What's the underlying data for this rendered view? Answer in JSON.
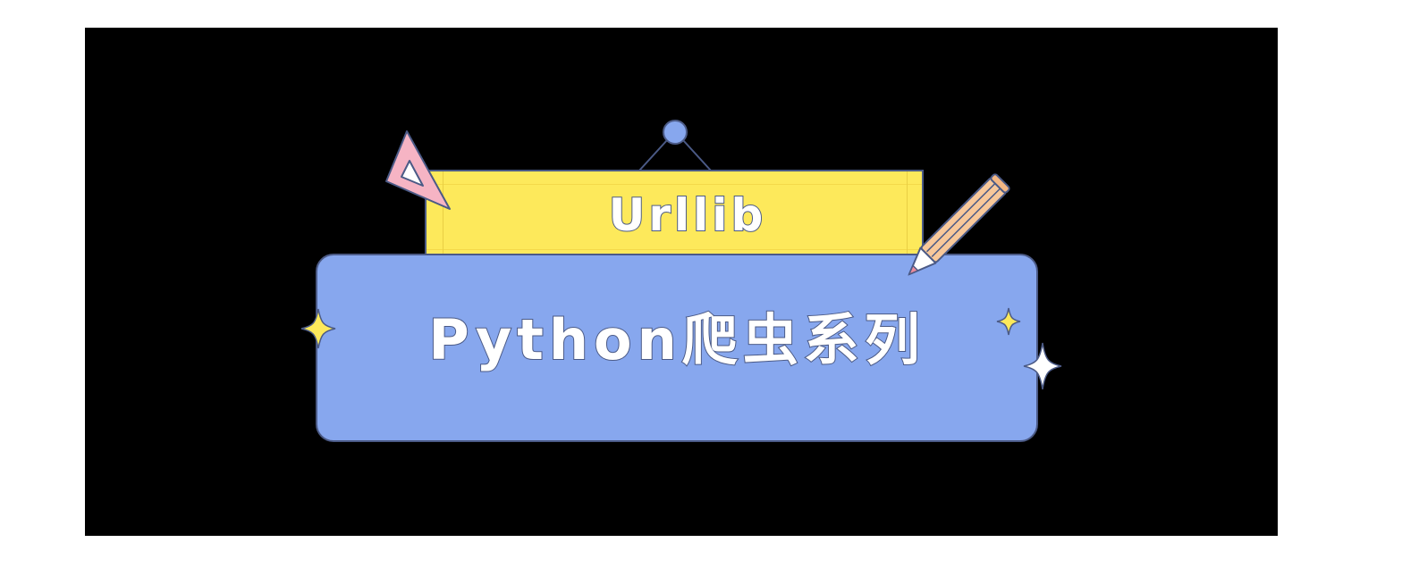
{
  "banner": {
    "subtitle": "Urllib",
    "title": "Python爬虫系列"
  },
  "colors": {
    "background": "#000000",
    "yellow_board": "#fde95b",
    "blue_board": "#87a7ee",
    "outline": "#4b5a86",
    "triangle": "#f6b4c4",
    "pencil_body": "#f8c89a",
    "sparkle_yellow": "#fde95b",
    "sparkle_white": "#ffffff"
  },
  "icons": {
    "hanger": "hanger-pin-icon",
    "triangle_ruler": "triangle-ruler-icon",
    "pencil": "pencil-icon",
    "sparkle_left": "sparkle-icon",
    "sparkle_right_small": "sparkle-icon",
    "sparkle_right_large": "sparkle-icon"
  }
}
